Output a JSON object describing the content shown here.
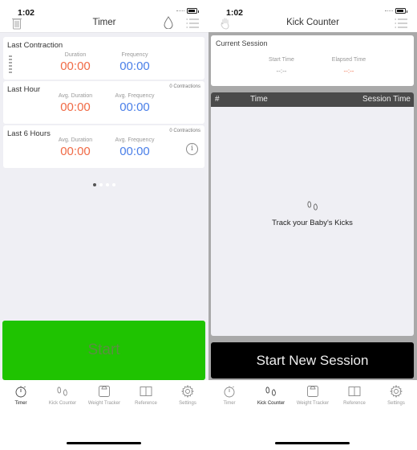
{
  "left": {
    "status_time": "1:02",
    "nav_title": "Timer",
    "cards": [
      {
        "title": "Last Contraction",
        "count": "",
        "duration_label": "Duration",
        "duration_value": "00:00",
        "frequency_label": "Frequency",
        "frequency_value": "00:00"
      },
      {
        "title": "Last Hour",
        "count": "0 Contractions",
        "duration_label": "Avg. Duration",
        "duration_value": "00:00",
        "frequency_label": "Avg. Frequency",
        "frequency_value": "00:00"
      },
      {
        "title": "Last 6 Hours",
        "count": "0 Contractions",
        "duration_label": "Avg. Duration",
        "duration_value": "00:00",
        "frequency_label": "Avg. Frequency",
        "frequency_value": "00:00",
        "info_glyph": "i"
      }
    ],
    "page_indicator": {
      "total": 4,
      "current": 1
    },
    "start_button": "Start",
    "start_color": "#1fc301"
  },
  "right": {
    "status_time": "1:02",
    "nav_title": "Kick Counter",
    "current_session": {
      "title": "Current Session",
      "start_time_label": "Start Time",
      "start_time_value": "--:--",
      "elapsed_time_label": "Elapsed Time",
      "elapsed_time_value": "--:--"
    },
    "table": {
      "columns": [
        "#",
        "Time",
        "Session Time"
      ],
      "rows": [],
      "empty_text": "Track your Baby's Kicks"
    },
    "new_session_button": "Start New Session"
  },
  "tabbar": {
    "items": [
      {
        "label": "Timer",
        "icon": "stopwatch-icon"
      },
      {
        "label": "Kick Counter",
        "icon": "footprints-icon"
      },
      {
        "label": "Weight Tracker",
        "icon": "scale-icon"
      },
      {
        "label": "Reference",
        "icon": "book-icon"
      },
      {
        "label": "Settings",
        "icon": "gear-icon"
      }
    ],
    "left_active": 0,
    "right_active": 1
  }
}
